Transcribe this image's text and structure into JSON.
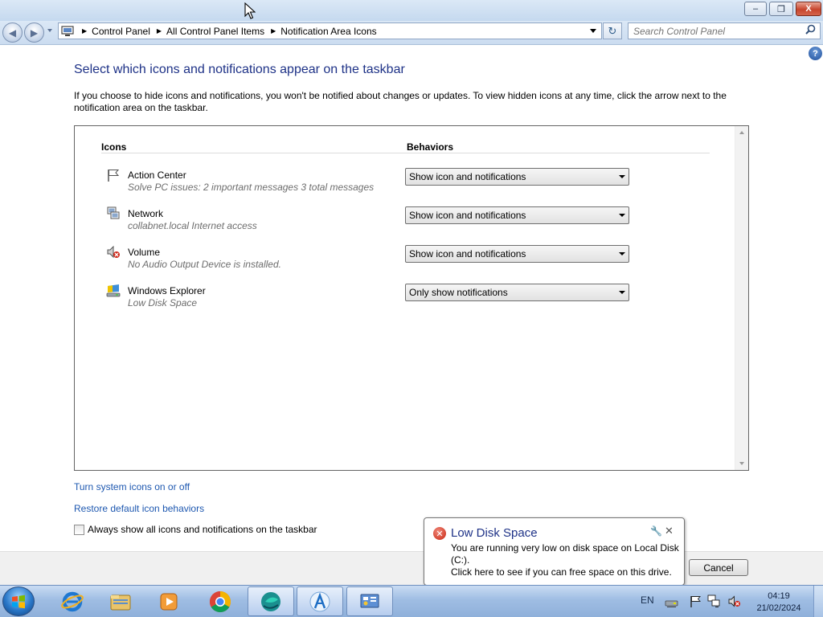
{
  "window": {
    "minimize_symbol": "–",
    "maximize_symbol": "❐",
    "close_symbol": "X"
  },
  "nav": {
    "breadcrumbs": [
      "Control Panel",
      "All Control Panel Items",
      "Notification Area Icons"
    ],
    "search_placeholder": "Search Control Panel"
  },
  "page": {
    "heading": "Select which icons and notifications appear on the taskbar",
    "intro": "If you choose to hide icons and notifications, you won't be notified about changes or updates. To view hidden icons at any time, click the arrow next to the notification area on the taskbar.",
    "col_icons": "Icons",
    "col_behaviors": "Behaviors",
    "rows": [
      {
        "name": "Action Center",
        "desc": "Solve PC issues: 2 important messages  3 total messages",
        "behavior": "Show icon and notifications",
        "icon": "flag-icon"
      },
      {
        "name": "Network",
        "desc": "collabnet.local Internet access",
        "behavior": "Show icon and notifications",
        "icon": "network-icon"
      },
      {
        "name": "Volume",
        "desc": "No Audio Output Device is installed.",
        "behavior": "Show icon and notifications",
        "icon": "volume-muted-icon"
      },
      {
        "name": "Windows Explorer",
        "desc": "Low Disk Space",
        "behavior": "Only show notifications",
        "icon": "drive-icon"
      }
    ],
    "link_system_icons": "Turn system icons on or off",
    "link_restore": "Restore default icon behaviors",
    "checkbox_label": "Always show all icons and notifications on the taskbar",
    "checkbox_checked": false,
    "cancel": "Cancel"
  },
  "balloon": {
    "title": "Low Disk Space",
    "body": "You are running very low on disk space on Local Disk (C:).\nClick here to see if you can free space on this drive.",
    "severity_color": "#c8230f"
  },
  "taskbar": {
    "apps": [
      {
        "name": "Internet Explorer",
        "icon": "ie-icon"
      },
      {
        "name": "Windows Explorer",
        "icon": "folder-icon"
      },
      {
        "name": "Windows Media Player",
        "icon": "media-player-icon"
      },
      {
        "name": "Google Chrome",
        "icon": "chrome-icon"
      },
      {
        "name": "Active app",
        "icon": "app-globe-icon"
      },
      {
        "name": "App",
        "icon": "app-a-icon"
      },
      {
        "name": "Control Panel",
        "icon": "control-panel-icon"
      }
    ],
    "language": "EN",
    "time": "04:19",
    "date": "21/02/2024"
  },
  "colors": {
    "heading": "#1e3287",
    "link": "#1e58b0",
    "desc_text": "#6d6d6d",
    "taskbar_top": "#c9dcf3"
  }
}
